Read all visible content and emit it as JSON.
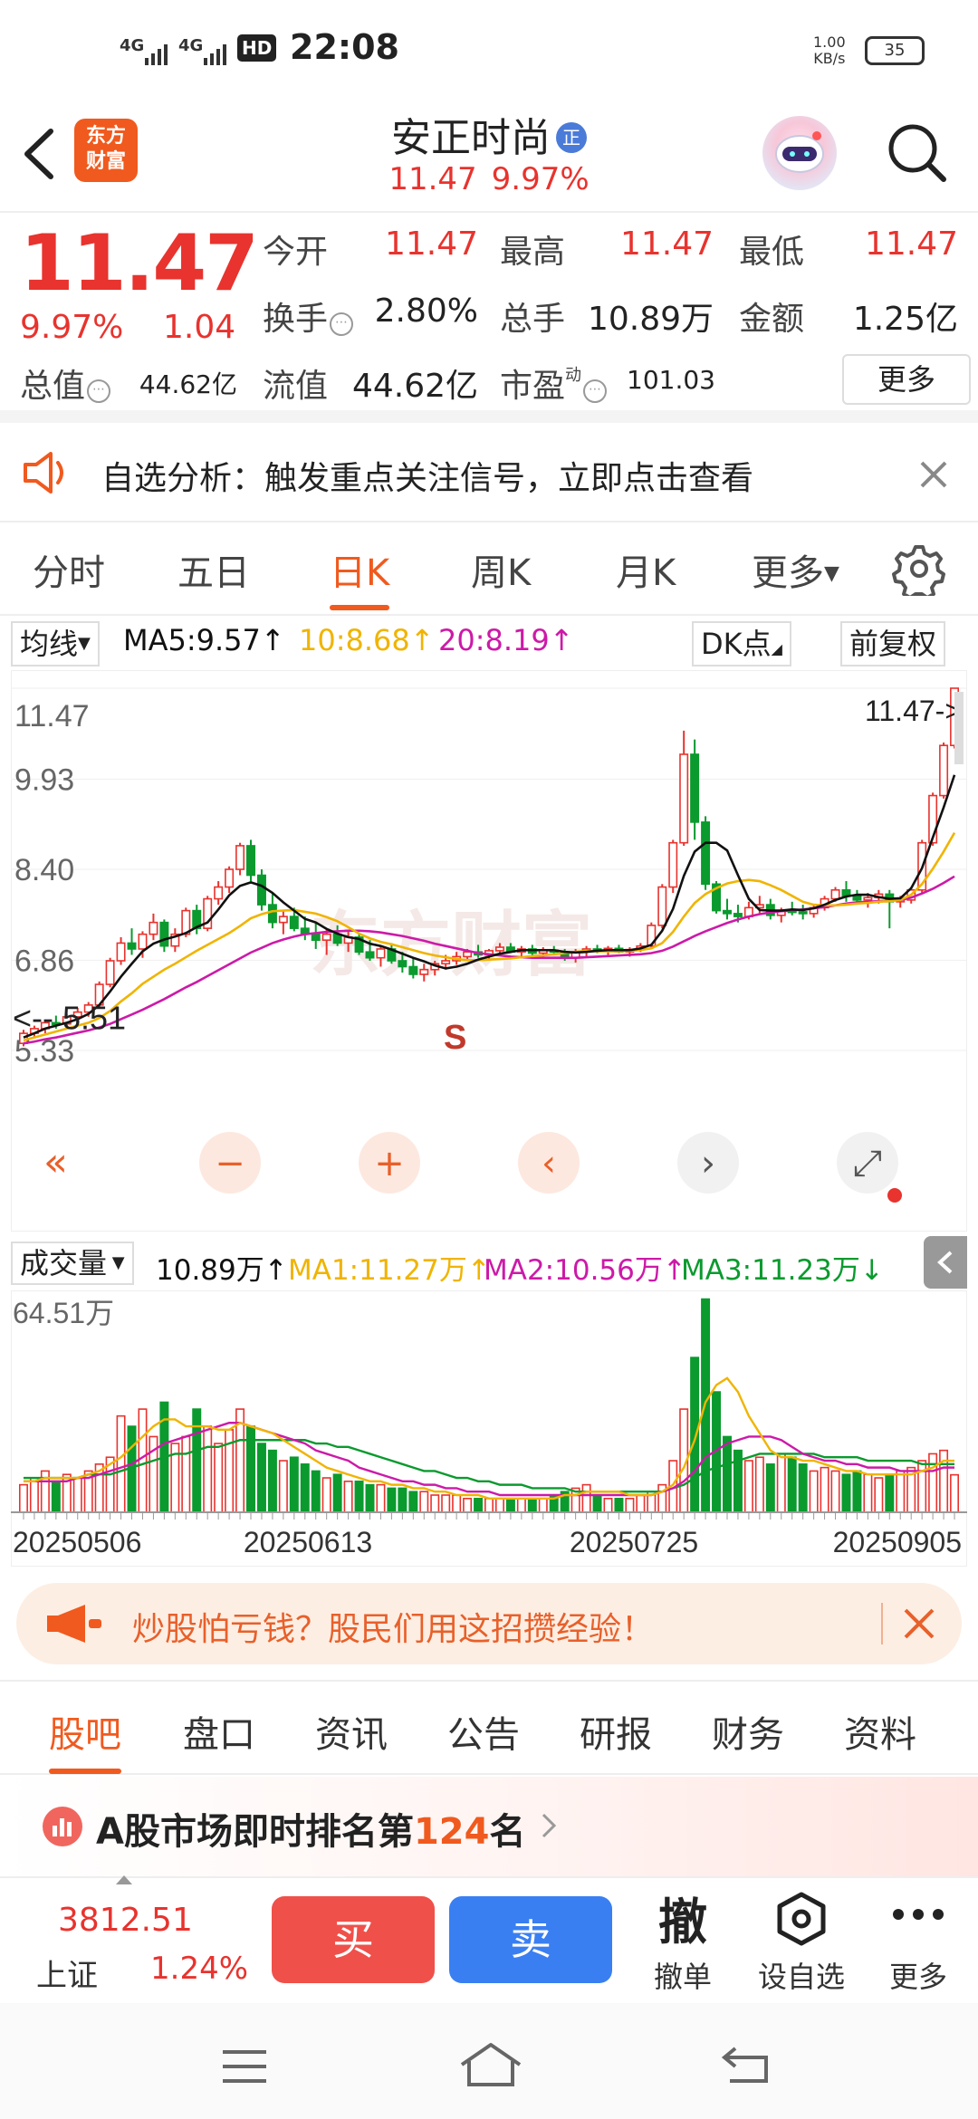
{
  "status_bar": {
    "sig1": "4G",
    "sig2": "4G",
    "hd": "HD",
    "time": "22:08",
    "speed_val": "1.00",
    "speed_unit": "KB/s",
    "battery": "35"
  },
  "header": {
    "logo_line1": "东方",
    "logo_line2": "财富",
    "title": "安正时尚",
    "badge": "正",
    "price": "11.47",
    "pct": "9.97%"
  },
  "quote": {
    "price": "11.47",
    "change_pct": "9.97%",
    "change_amt": "1.04",
    "open_label": "今开",
    "open": "11.47",
    "high_label": "最高",
    "high": "11.47",
    "low_label": "最低",
    "low": "11.47",
    "turnover_label": "换手",
    "turnover": "2.80%",
    "volume_label": "总手",
    "volume": "10.89万",
    "amount_label": "金额",
    "amount": "1.25亿",
    "total_cap_label": "总值",
    "total_cap": "44.62亿",
    "float_cap_label": "流值",
    "float_cap": "44.62亿",
    "pe_label": "市盈",
    "pe_sup": "动",
    "pe": "101.03",
    "more": "更多"
  },
  "notice": {
    "text": "自选分析：触发重点关注信号，立即点击查看"
  },
  "tabs": [
    "分时",
    "五日",
    "日K",
    "周K",
    "月K",
    "更多"
  ],
  "active_tab": "日K",
  "ma_bar": {
    "select": "均线",
    "ma5": "MA5:9.57",
    "ma10": "10:8.68",
    "ma20": "20:8.19",
    "dk": "DK点",
    "adjust": "前复权"
  },
  "colors": {
    "up": "#e8332e",
    "down": "#0a9a2e",
    "accent": "#f05a1e",
    "ma5": "#111111",
    "ma10": "#f0b400",
    "ma20": "#cc1aa8"
  },
  "chart_data": [
    {
      "type": "candlestick",
      "y_ticks": [
        "11.47",
        "9.93",
        "8.40",
        "6.86",
        "5.33"
      ],
      "ylim": [
        5.33,
        11.47
      ],
      "last_price_tag": "11.47->",
      "min_label": "5.51",
      "signal_label": "S",
      "watermark": "东方财富",
      "ohlc": [
        [
          5.45,
          5.68,
          5.4,
          5.62
        ],
        [
          5.62,
          5.75,
          5.55,
          5.7
        ],
        [
          5.7,
          5.85,
          5.62,
          5.8
        ],
        [
          5.8,
          5.92,
          5.7,
          5.78
        ],
        [
          5.78,
          5.95,
          5.72,
          5.9
        ],
        [
          5.9,
          6.05,
          5.82,
          5.98
        ],
        [
          5.98,
          6.15,
          5.9,
          6.1
        ],
        [
          6.1,
          6.5,
          6.05,
          6.45
        ],
        [
          6.45,
          6.9,
          6.4,
          6.85
        ],
        [
          6.85,
          7.25,
          6.78,
          7.15
        ],
        [
          7.15,
          7.4,
          6.95,
          7.05
        ],
        [
          7.05,
          7.35,
          6.9,
          7.3
        ],
        [
          7.3,
          7.65,
          7.2,
          7.5
        ],
        [
          7.5,
          7.55,
          7.0,
          7.1
        ],
        [
          7.1,
          7.4,
          7.0,
          7.3
        ],
        [
          7.3,
          7.75,
          7.25,
          7.7
        ],
        [
          7.7,
          7.8,
          7.3,
          7.4
        ],
        [
          7.4,
          7.95,
          7.35,
          7.9
        ],
        [
          7.9,
          8.2,
          7.8,
          8.1
        ],
        [
          8.1,
          8.45,
          8.0,
          8.4
        ],
        [
          8.4,
          8.85,
          8.3,
          8.8
        ],
        [
          8.8,
          8.9,
          8.2,
          8.3
        ],
        [
          8.3,
          8.4,
          7.7,
          7.8
        ],
        [
          7.8,
          8.0,
          7.4,
          7.5
        ],
        [
          7.5,
          7.7,
          7.3,
          7.6
        ],
        [
          7.6,
          7.75,
          7.35,
          7.4
        ],
        [
          7.4,
          7.6,
          7.2,
          7.3
        ],
        [
          7.3,
          7.5,
          7.05,
          7.2
        ],
        [
          7.2,
          7.4,
          6.95,
          7.3
        ],
        [
          7.3,
          7.45,
          7.1,
          7.15
        ],
        [
          7.15,
          7.35,
          7.0,
          7.25
        ],
        [
          7.25,
          7.3,
          6.95,
          7.0
        ],
        [
          7.0,
          7.2,
          6.85,
          6.9
        ],
        [
          6.9,
          7.1,
          6.75,
          7.05
        ],
        [
          7.05,
          7.15,
          6.8,
          6.85
        ],
        [
          6.85,
          7.0,
          6.65,
          6.75
        ],
        [
          6.75,
          6.9,
          6.55,
          6.62
        ],
        [
          6.62,
          6.8,
          6.5,
          6.7
        ],
        [
          6.7,
          6.85,
          6.6,
          6.8
        ],
        [
          6.8,
          6.95,
          6.7,
          6.85
        ],
        [
          6.85,
          7.0,
          6.78,
          6.92
        ],
        [
          6.92,
          7.05,
          6.85,
          7.0
        ],
        [
          7.0,
          7.12,
          6.9,
          6.95
        ],
        [
          6.95,
          7.05,
          6.85,
          7.02
        ],
        [
          7.02,
          7.15,
          6.95,
          7.08
        ],
        [
          7.08,
          7.15,
          6.98,
          7.0
        ],
        [
          7.0,
          7.1,
          6.92,
          7.05
        ],
        [
          7.05,
          7.12,
          6.95,
          6.98
        ],
        [
          6.98,
          7.08,
          6.9,
          7.03
        ],
        [
          7.03,
          7.1,
          6.95,
          7.0
        ],
        [
          7.0,
          7.05,
          6.85,
          6.9
        ],
        [
          6.9,
          7.05,
          6.82,
          7.0
        ],
        [
          7.0,
          7.1,
          6.92,
          7.05
        ],
        [
          7.05,
          7.12,
          6.98,
          7.02
        ],
        [
          7.02,
          7.1,
          6.95,
          7.06
        ],
        [
          7.06,
          7.12,
          6.98,
          7.0
        ],
        [
          7.0,
          7.08,
          6.92,
          7.04
        ],
        [
          7.04,
          7.15,
          7.0,
          7.1
        ],
        [
          7.1,
          7.5,
          7.05,
          7.45
        ],
        [
          7.45,
          8.15,
          7.4,
          8.1
        ],
        [
          8.1,
          8.9,
          8.0,
          8.85
        ],
        [
          8.85,
          10.75,
          8.8,
          10.35
        ],
        [
          10.35,
          10.6,
          8.9,
          9.2
        ],
        [
          9.2,
          9.3,
          8.05,
          8.15
        ],
        [
          8.15,
          8.2,
          7.65,
          7.7
        ],
        [
          7.7,
          7.9,
          7.55,
          7.65
        ],
        [
          7.65,
          7.8,
          7.5,
          7.6
        ],
        [
          7.6,
          7.85,
          7.55,
          7.75
        ],
        [
          7.75,
          7.95,
          7.65,
          7.8
        ],
        [
          7.8,
          7.9,
          7.55,
          7.62
        ],
        [
          7.62,
          7.75,
          7.5,
          7.7
        ],
        [
          7.7,
          7.85,
          7.62,
          7.68
        ],
        [
          7.68,
          7.8,
          7.55,
          7.65
        ],
        [
          7.65,
          7.8,
          7.58,
          7.75
        ],
        [
          7.75,
          7.95,
          7.7,
          7.9
        ],
        [
          7.9,
          8.1,
          7.85,
          8.05
        ],
        [
          8.05,
          8.2,
          7.85,
          7.95
        ],
        [
          7.95,
          8.05,
          7.8,
          7.88
        ],
        [
          7.88,
          8.0,
          7.75,
          7.92
        ],
        [
          7.92,
          8.05,
          7.82,
          7.98
        ],
        [
          7.98,
          8.05,
          7.4,
          7.85
        ],
        [
          7.85,
          7.95,
          7.75,
          7.88
        ],
        [
          7.88,
          8.1,
          7.82,
          8.05
        ],
        [
          8.05,
          8.9,
          8.0,
          8.85
        ],
        [
          8.85,
          9.7,
          8.8,
          9.65
        ],
        [
          9.65,
          10.55,
          9.6,
          10.5
        ],
        [
          10.5,
          11.47,
          10.45,
          11.47
        ]
      ],
      "ma5": [
        5.55,
        5.62,
        5.7,
        5.75,
        5.8,
        5.86,
        5.95,
        6.1,
        6.33,
        6.58,
        6.8,
        7.01,
        7.14,
        7.21,
        7.26,
        7.32,
        7.42,
        7.5,
        7.72,
        7.96,
        8.12,
        8.18,
        8.12,
        8.0,
        7.84,
        7.7,
        7.56,
        7.5,
        7.39,
        7.31,
        7.25,
        7.22,
        7.14,
        7.1,
        7.04,
        6.97,
        6.9,
        6.84,
        6.77,
        6.72,
        6.75,
        6.8,
        6.87,
        6.92,
        6.97,
        7.0,
        7.03,
        7.03,
        7.03,
        7.03,
        7.0,
        6.99,
        7.0,
        7.02,
        7.03,
        7.03,
        7.03,
        7.06,
        7.12,
        7.36,
        7.73,
        8.29,
        8.7,
        8.85,
        8.85,
        8.72,
        8.3,
        7.9,
        7.71,
        7.7,
        7.7,
        7.72,
        7.71,
        7.74,
        7.8,
        7.88,
        7.94,
        7.97,
        7.97,
        7.93,
        7.9,
        7.91,
        8.08,
        8.42,
        8.94,
        9.45,
        10.0
      ],
      "ma10": [
        5.5,
        5.55,
        5.6,
        5.65,
        5.7,
        5.75,
        5.8,
        5.88,
        6.0,
        6.16,
        6.3,
        6.46,
        6.58,
        6.7,
        6.8,
        6.91,
        7.02,
        7.12,
        7.22,
        7.32,
        7.44,
        7.57,
        7.64,
        7.69,
        7.7,
        7.71,
        7.68,
        7.65,
        7.59,
        7.52,
        7.42,
        7.31,
        7.23,
        7.17,
        7.13,
        7.08,
        7.03,
        6.98,
        6.94,
        6.91,
        6.88,
        6.86,
        6.86,
        6.87,
        6.88,
        6.89,
        6.91,
        6.93,
        6.94,
        6.96,
        6.98,
        7.0,
        7.02,
        7.01,
        7.01,
        7.01,
        7.02,
        7.03,
        7.06,
        7.15,
        7.34,
        7.6,
        7.83,
        7.98,
        8.08,
        8.16,
        8.2,
        8.22,
        8.2,
        8.13,
        8.05,
        7.95,
        7.85,
        7.8,
        7.79,
        7.79,
        7.8,
        7.82,
        7.83,
        7.85,
        7.86,
        7.88,
        7.97,
        8.15,
        8.41,
        8.7,
        9.02
      ],
      "ma20": [
        5.45,
        5.48,
        5.52,
        5.55,
        5.59,
        5.63,
        5.67,
        5.72,
        5.78,
        5.86,
        5.94,
        6.02,
        6.11,
        6.2,
        6.3,
        6.4,
        6.49,
        6.59,
        6.69,
        6.79,
        6.89,
        6.99,
        7.07,
        7.15,
        7.21,
        7.26,
        7.3,
        7.32,
        7.34,
        7.35,
        7.36,
        7.36,
        7.35,
        7.33,
        7.3,
        7.27,
        7.23,
        7.19,
        7.14,
        7.1,
        7.06,
        7.02,
        6.98,
        6.96,
        6.94,
        6.92,
        6.91,
        6.9,
        6.9,
        6.9,
        6.9,
        6.9,
        6.91,
        6.92,
        6.93,
        6.94,
        6.95,
        6.96,
        6.98,
        7.02,
        7.09,
        7.18,
        7.27,
        7.35,
        7.42,
        7.49,
        7.55,
        7.6,
        7.64,
        7.67,
        7.69,
        7.7,
        7.72,
        7.74,
        7.76,
        7.79,
        7.82,
        7.84,
        7.85,
        7.86,
        7.87,
        7.88,
        7.92,
        7.99,
        8.07,
        8.17,
        8.28
      ]
    },
    {
      "type": "bar",
      "y_ticks": [
        "64.51万"
      ],
      "ylim": [
        0,
        64.51
      ],
      "x_ticks": [
        "20250506",
        "20250613",
        "20250725",
        "20250905"
      ],
      "values": [
        8,
        10,
        12,
        9,
        11,
        10,
        12,
        14,
        16,
        28,
        25,
        30,
        22,
        32,
        20,
        22,
        30,
        25,
        20,
        24,
        30,
        25,
        20,
        18,
        15,
        16,
        14,
        12,
        10,
        11,
        9,
        9,
        8,
        8,
        7,
        7,
        6,
        6,
        5,
        5,
        5,
        4,
        4,
        4,
        4,
        4,
        4,
        4,
        4,
        5,
        6,
        7,
        8,
        5,
        4,
        4,
        4,
        5,
        6,
        8,
        15,
        30,
        45,
        62,
        35,
        22,
        18,
        15,
        16,
        14,
        17,
        16,
        14,
        12,
        13,
        12,
        11,
        12,
        11,
        10,
        11,
        12,
        13,
        15,
        17,
        18,
        10.89
      ],
      "ma1": [
        9,
        9,
        10,
        10,
        10,
        10,
        11,
        12,
        14,
        16,
        19,
        22,
        25,
        27,
        27,
        25,
        25,
        25,
        24,
        24,
        26,
        25,
        24,
        23,
        21,
        19,
        17,
        15,
        13,
        12,
        11,
        10,
        9,
        9,
        8,
        8,
        7,
        7,
        6,
        6,
        5,
        5,
        5,
        4,
        4,
        4,
        4,
        4,
        4,
        4,
        5,
        5,
        6,
        6,
        6,
        6,
        5,
        5,
        5,
        6,
        8,
        13,
        21,
        32,
        37,
        39,
        35,
        28,
        23,
        18,
        16,
        16,
        15,
        15,
        14,
        13,
        12,
        12,
        11,
        11,
        11,
        11,
        11,
        12,
        13,
        15,
        15
      ],
      "ma2": [
        9,
        9,
        9,
        9,
        9,
        10,
        10,
        11,
        12,
        13,
        14,
        16,
        18,
        20,
        21,
        22,
        23,
        24,
        25,
        26,
        26,
        25,
        24,
        23,
        22,
        21,
        20,
        18,
        17,
        16,
        15,
        13,
        12,
        11,
        10,
        9,
        9,
        8,
        8,
        7,
        7,
        6,
        6,
        6,
        5,
        5,
        5,
        5,
        5,
        5,
        5,
        5,
        5,
        5,
        5,
        5,
        5,
        5,
        5,
        6,
        7,
        9,
        12,
        16,
        18,
        20,
        21,
        22,
        22,
        22,
        21,
        19,
        17,
        16,
        15,
        15,
        14,
        14,
        13,
        13,
        13,
        12,
        12,
        12,
        12,
        13,
        13
      ],
      "ma3": [
        10,
        10,
        10,
        10,
        10,
        10,
        11,
        11,
        11,
        12,
        13,
        14,
        15,
        16,
        17,
        17,
        18,
        19,
        19,
        20,
        21,
        21,
        21,
        21,
        21,
        21,
        21,
        20,
        20,
        19,
        19,
        18,
        17,
        16,
        15,
        14,
        13,
        12,
        12,
        11,
        10,
        10,
        9,
        9,
        8,
        8,
        8,
        7,
        7,
        7,
        7,
        6,
        6,
        6,
        6,
        6,
        6,
        6,
        6,
        6,
        7,
        8,
        10,
        12,
        13,
        14,
        15,
        16,
        17,
        17,
        17,
        17,
        17,
        17,
        16,
        16,
        16,
        16,
        15,
        15,
        15,
        15,
        15,
        14,
        14,
        14,
        14
      ]
    }
  ],
  "volume_bar": {
    "select": "成交量",
    "vol": "10.89万",
    "ma1": "MA1:11.27万",
    "ma2": "MA2:10.56万",
    "ma3": "MA3:11.23万"
  },
  "ad": {
    "text": "炒股怕亏钱？股民们用这招攒经验！"
  },
  "sub_tabs": [
    "股吧",
    "盘口",
    "资讯",
    "公告",
    "研报",
    "财务",
    "资料"
  ],
  "rank": {
    "prefix": "A股市场即时排名第",
    "num": "124",
    "suffix": "名"
  },
  "bottom_bar": {
    "index_value": "3812.51",
    "index_name": "上证",
    "index_pct": "1.24%",
    "buy": "买",
    "sell": "卖",
    "cancel": "撤单",
    "cancel_glyph": "撤",
    "watch": "设自选",
    "more": "更多"
  }
}
